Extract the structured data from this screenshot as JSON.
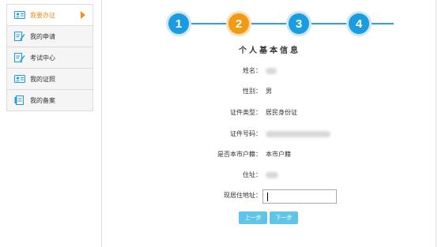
{
  "sidebar": {
    "items": [
      {
        "label": "我要办证",
        "icon": "id-card-icon",
        "active": true
      },
      {
        "label": "我的申请",
        "icon": "edit-form-icon",
        "active": false
      },
      {
        "label": "考试中心",
        "icon": "edit-form-icon",
        "active": false
      },
      {
        "label": "我的证照",
        "icon": "id-card-icon",
        "active": false
      },
      {
        "label": "我的备案",
        "icon": "record-book-icon",
        "active": false
      }
    ]
  },
  "steps": {
    "items": [
      "1",
      "2",
      "3",
      "4"
    ],
    "current": 2
  },
  "form": {
    "title": "个人基本信息",
    "name_label": "姓名：",
    "name_value": "",
    "gender_label": "性别：",
    "gender_value": "男",
    "id_type_label": "证件类型：",
    "id_type_value": "居民身份证",
    "id_number_label": "证件号码：",
    "id_number_value": "",
    "local_label": "是否本市户籍：",
    "local_value": "本市户籍",
    "address_label": "住址：",
    "address_value": "",
    "current_address_label": "现居住地址：",
    "current_address_value": "",
    "prev_button": "上一步",
    "next_button": "下一步"
  },
  "colors": {
    "accent_orange": "#f39a14",
    "step_blue": "#1b9be0",
    "button_blue": "#5fc4e8"
  }
}
